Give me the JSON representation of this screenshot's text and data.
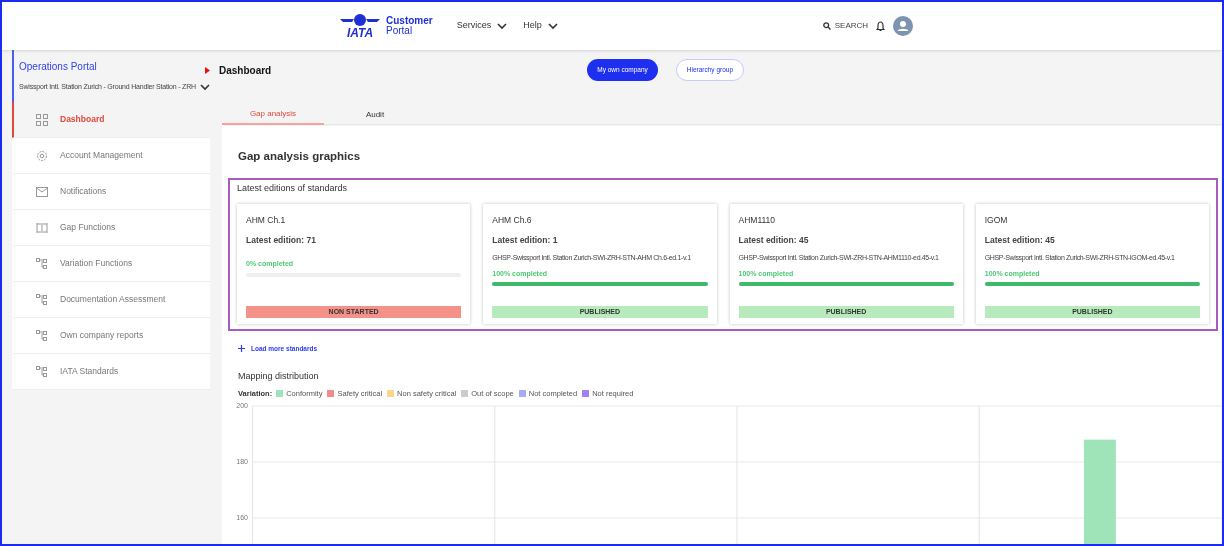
{
  "header": {
    "logo_text": "IATA",
    "brand_line1": "Customer",
    "brand_line2": "Portal",
    "nav": [
      {
        "label": "Services"
      },
      {
        "label": "Help"
      }
    ],
    "search": "SEARCH"
  },
  "portal": {
    "title": "Operations Portal",
    "station": "Swissport Intl. Station Zurich - Ground Handler Station - ZRH"
  },
  "sidebar": {
    "items": [
      {
        "label": "Dashboard",
        "selected": true
      },
      {
        "label": "Account Management",
        "selected": false
      },
      {
        "label": "Notifications",
        "selected": false
      },
      {
        "label": "Gap Functions",
        "selected": false
      },
      {
        "label": "Variation Functions",
        "selected": false
      },
      {
        "label": "Documentation Assessment",
        "selected": false
      },
      {
        "label": "Own company reports",
        "selected": false
      },
      {
        "label": "IATA Standards",
        "selected": false
      }
    ]
  },
  "breadcrumb": "Dashboard",
  "scope_buttons": [
    {
      "label": "My own company",
      "selected": true
    },
    {
      "label": "Hierarchy group",
      "selected": false
    }
  ],
  "tabs": [
    {
      "label": "Gap analysis",
      "selected": true
    },
    {
      "label": "Audit",
      "selected": false
    }
  ],
  "section_title": "Gap analysis graphics",
  "standards": {
    "title": "Latest editions of standards",
    "cards": [
      {
        "name": "AHM Ch.1",
        "edition": "Latest edition: 71",
        "progress_label": "0% completed",
        "level": 0,
        "status": "NON STARTED",
        "kind": "not_started"
      },
      {
        "name": "AHM Ch.6",
        "edition": "Latest edition: 1",
        "code": "GHSP-Swissport Intl. Station Zurich-SWI-ZRH-STN-AHM Ch.6-ed.1-v.1",
        "progress_label": "100% completed",
        "level": 1,
        "status": "PUBLISHED",
        "kind": "published"
      },
      {
        "name": "AHM1110",
        "edition": "Latest edition: 45",
        "code": "GHSP-Swissport Intl. Station Zurich-SWI-ZRH-STN-AHM1110-ed.45-v.1",
        "progress_label": "100% completed",
        "level": 1,
        "status": "PUBLISHED",
        "kind": "published"
      },
      {
        "name": "IGOM",
        "edition": "Latest edition: 45",
        "code": "GHSP-Swissport Intl. Station Zurich-SWI-ZRH-STN-IGOM-ed.45-v.1",
        "progress_label": "100% completed",
        "level": 1,
        "status": "PUBLISHED",
        "kind": "published"
      }
    ],
    "load_more": "Load more standards"
  },
  "mapping": {
    "title": "Mapping distribution",
    "legend_label": "Variation:",
    "chart_data": {
      "type": "bar",
      "ylim": [
        150,
        200
      ],
      "yticks": [
        200,
        180,
        160
      ],
      "series": [
        {
          "name": "Conformity",
          "color": "#9fe3b8",
          "values": [
            null,
            null,
            null,
            188
          ]
        },
        {
          "name": "Safety critical",
          "color": "#f08c8c",
          "values": [
            null,
            null,
            null,
            null
          ]
        },
        {
          "name": "Non safety critical",
          "color": "#f8d98c",
          "values": [
            null,
            null,
            null,
            null
          ]
        },
        {
          "name": "Out of scope",
          "color": "#cccccc",
          "values": [
            null,
            null,
            null,
            null
          ]
        },
        {
          "name": "Not completed",
          "color": "#a3acf5",
          "values": [
            null,
            null,
            null,
            null
          ]
        },
        {
          "name": "Not required",
          "color": "#a67ef0",
          "values": [
            null,
            null,
            null,
            null
          ]
        }
      ]
    }
  }
}
